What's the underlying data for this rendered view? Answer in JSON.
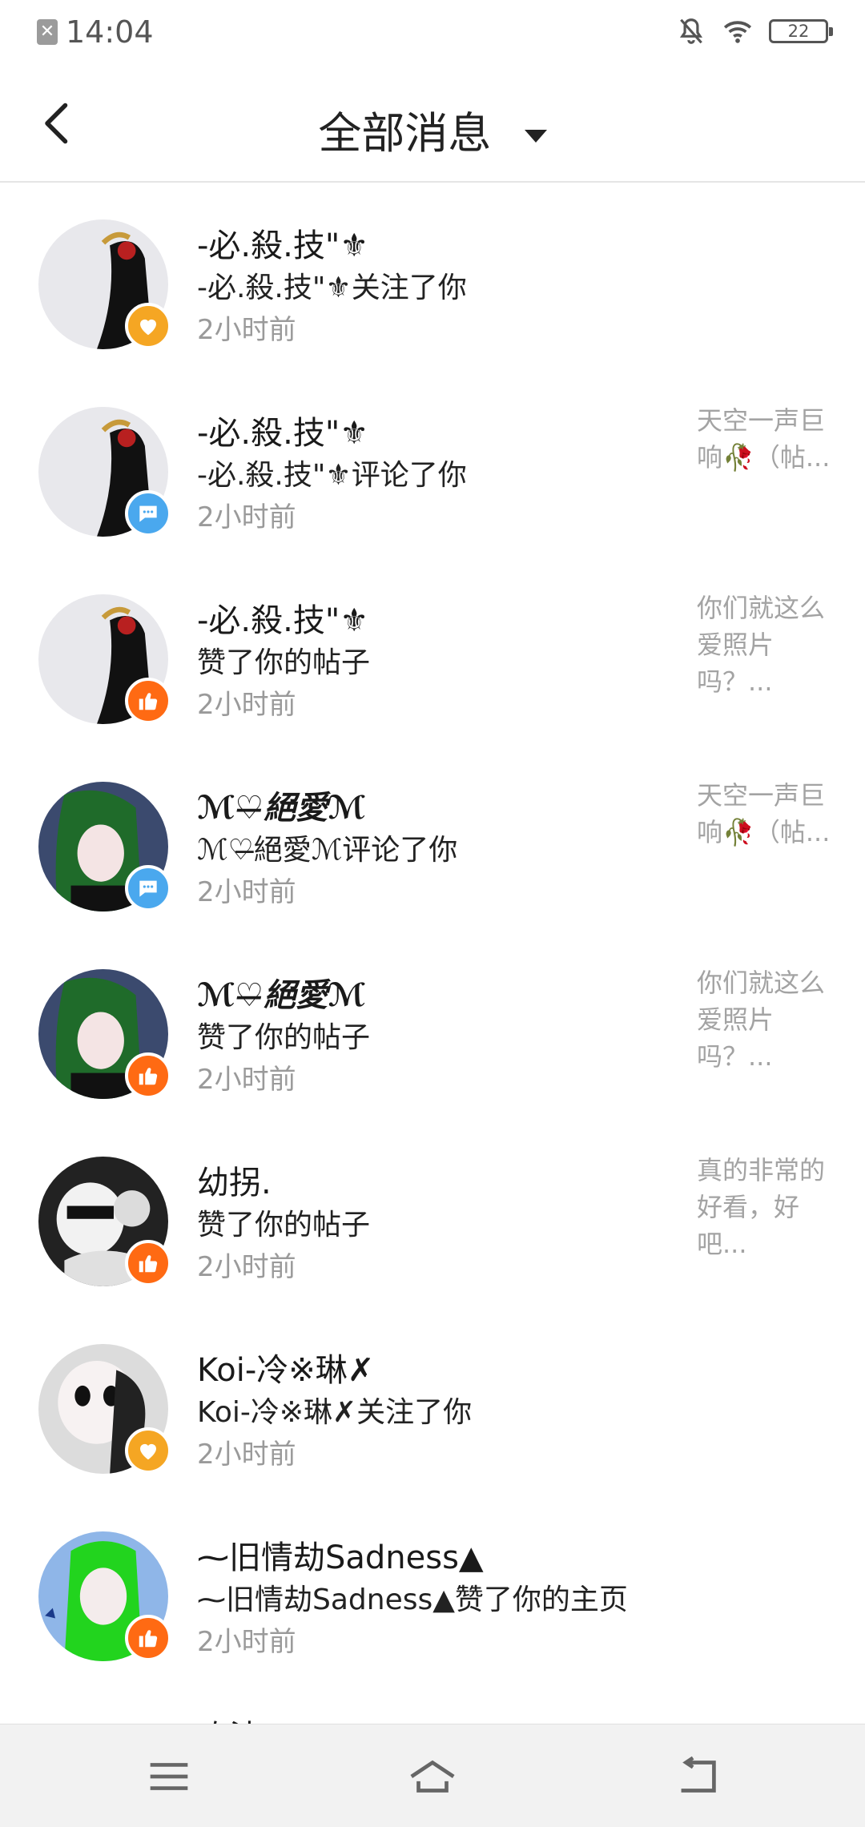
{
  "status": {
    "time": "14:04",
    "battery": "22"
  },
  "header": {
    "title": "全部消息"
  },
  "notifications": [
    {
      "name": "-必.殺.技\"⚜",
      "action": "-必.殺.技\"⚜关注了你",
      "time": "2小时前",
      "type": "follow",
      "preview": ""
    },
    {
      "name": "-必.殺.技\"⚜",
      "action": "-必.殺.技\"⚜评论了你",
      "time": "2小时前",
      "type": "comment",
      "preview": "天空一声巨响🥀（帖..."
    },
    {
      "name": "-必.殺.技\"⚜",
      "action": "赞了你的帖子",
      "time": "2小时前",
      "type": "like",
      "preview": "你们就这么爱照片吗？..."
    },
    {
      "name": "ℳ♡̶絕愛ℳ",
      "action": "ℳ♡̶絕愛ℳ评论了你",
      "time": "2小时前",
      "type": "comment",
      "preview": "天空一声巨响🥀（帖..."
    },
    {
      "name": "ℳ♡̶絕愛ℳ",
      "action": "赞了你的帖子",
      "time": "2小时前",
      "type": "like",
      "preview": "你们就这么爱照片吗？..."
    },
    {
      "name": "幼拐.",
      "action": "赞了你的帖子",
      "time": "2小时前",
      "type": "like",
      "preview": "真的非常的好看，好吧..."
    },
    {
      "name": "Koi-冷※琳✗",
      "action": "Koi-冷※琳✗关注了你",
      "time": "2小时前",
      "type": "follow",
      "preview": ""
    },
    {
      "name": "⁓旧情劫Sadness▲",
      "action": "⁓旧情劫Sadness▲赞了你的主页",
      "time": "2小时前",
      "type": "like",
      "preview": ""
    }
  ],
  "partial_row": {
    "name": "玫法"
  },
  "icons": {
    "follow": "heart-icon",
    "comment": "chat-bubble-icon",
    "like": "thumbs-up-icon"
  },
  "colors": {
    "follow": "#f5a623",
    "comment": "#4aa8ee",
    "like": "#ff6a13"
  }
}
